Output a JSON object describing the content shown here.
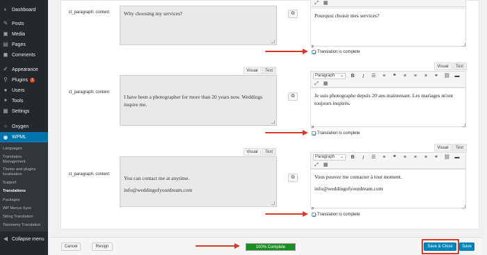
{
  "sidebar": {
    "items": [
      {
        "label": "Dashboard",
        "icon": "dashboard-icon",
        "glyph": "◐"
      },
      {
        "label": "Posts",
        "icon": "pin-icon",
        "glyph": "✎"
      },
      {
        "label": "Media",
        "icon": "media-icon",
        "glyph": "▣"
      },
      {
        "label": "Pages",
        "icon": "page-icon",
        "glyph": "▤"
      },
      {
        "label": "Comments",
        "icon": "comment-icon",
        "glyph": "◼"
      },
      {
        "label": "Appearance",
        "icon": "brush-icon",
        "glyph": "✐"
      },
      {
        "label": "Plugins",
        "icon": "plug-icon",
        "glyph": "⚲",
        "badge": "1"
      },
      {
        "label": "Users",
        "icon": "user-icon",
        "glyph": "●"
      },
      {
        "label": "Tools",
        "icon": "wrench-icon",
        "glyph": "✦"
      },
      {
        "label": "Settings",
        "icon": "settings-icon",
        "glyph": "▦"
      },
      {
        "label": "Oxygen",
        "icon": "oxygen-icon",
        "glyph": "○"
      },
      {
        "label": "WPML",
        "icon": "wpml-icon",
        "glyph": "◉"
      }
    ],
    "wpml_submenu": [
      "Languages",
      "Translation Management",
      "Theme and plugins localization",
      "Support",
      "Translations",
      "Packages",
      "WP Menus Sync",
      "String Translation",
      "Taxonomy Translation"
    ],
    "collapse_label": "Collapse menu"
  },
  "fields": [
    {
      "label": "ct_paragraph: content",
      "original": [
        "Why choosing my services?"
      ],
      "translation": [
        "Pourquoi choisir mes services?"
      ],
      "p_tag": "p",
      "complete_label": "Translation is complete"
    },
    {
      "label": "ct_paragraph: content",
      "original": [
        "I have been a photographer for more than 20 years now. Weddings inspire me."
      ],
      "translation": [
        "Je suis photographe depuis 20 ans maintenant. Les mariages m'ont toujours inspirés."
      ],
      "p_tag": "p",
      "complete_label": "Translation is complete"
    },
    {
      "label": "ct_paragraph: content",
      "original": [
        "You can contact me at anytime.",
        "info@weddingofyourdream.com"
      ],
      "translation": [
        "Vous pouvez me contacter à tout moment.",
        "info@weddingofyourdream.com"
      ],
      "p_tag": "p",
      "complete_label": "Translation is complete"
    }
  ],
  "editor": {
    "tab_visual": "Visual",
    "tab_text": "Text",
    "format_select": "Paragraph"
  },
  "footer": {
    "cancel_label": "Cancel",
    "resign_label": "Resign",
    "progress_text": "100% Complete",
    "progress_fraction": 1.0,
    "save_close_label": "Save & Close",
    "save_label": "Save"
  },
  "colors": {
    "sidebar_bg": "#23282d",
    "accent": "#0073aa",
    "primary_button": "#0085ba",
    "progress_fill": "#1b8e23",
    "annotation_red": "#d63a24"
  }
}
